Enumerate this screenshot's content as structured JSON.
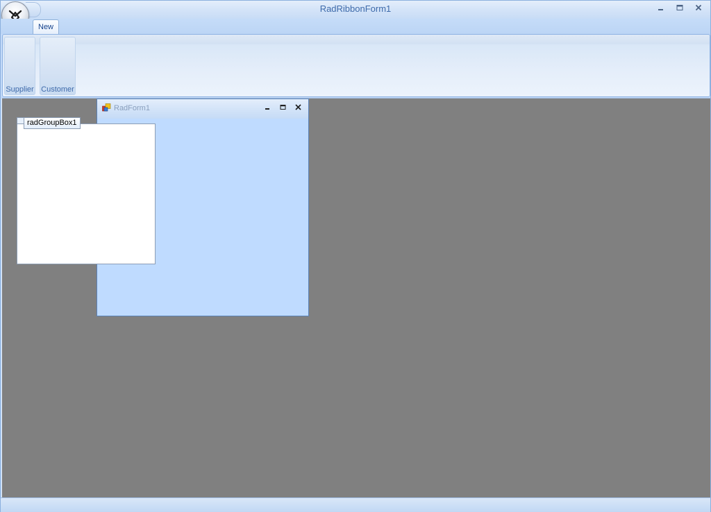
{
  "window": {
    "title": "RadRibbonForm1",
    "minimize_icon": "minimize-icon",
    "maximize_icon": "maximize-icon",
    "close_icon": "close-icon"
  },
  "app_orb": {
    "icon": "telerik-logo-icon"
  },
  "ribbon": {
    "tabs": [
      {
        "label": "New",
        "active": true
      }
    ],
    "buttons": [
      {
        "label": "Supplier"
      },
      {
        "label": "Customer"
      }
    ]
  },
  "child_form": {
    "title": "RadForm1",
    "icon": "form-icon"
  },
  "group_box": {
    "header": "radGroupBox1"
  },
  "colors": {
    "mdi_background": "#808080",
    "ribbon_text": "#15428b",
    "title_text": "#3e6aaa",
    "child_client": "#bfdbff"
  }
}
